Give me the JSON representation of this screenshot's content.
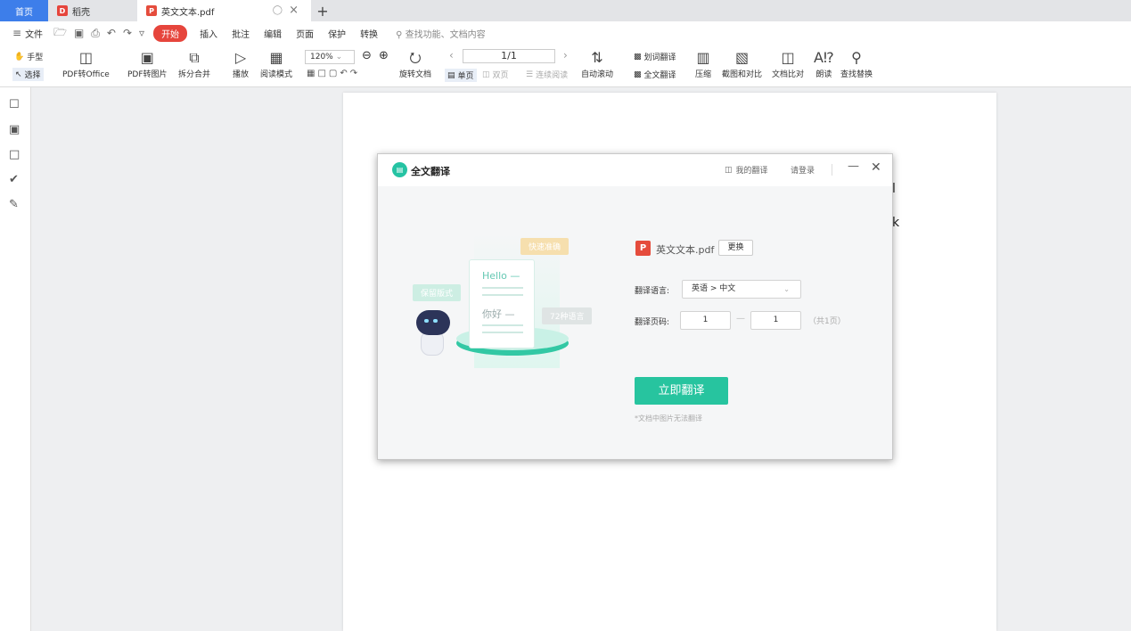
{
  "tabs": {
    "home": "首页",
    "daoke": "稻壳",
    "doc": "英文文本.pdf",
    "add": "+"
  },
  "menu": {
    "file": "文件",
    "start": "开始",
    "items": [
      "插入",
      "批注",
      "编辑",
      "页面",
      "保护",
      "转换"
    ],
    "search": "查找功能、文档内容"
  },
  "ribbon": {
    "hand": "手型",
    "select": "选择",
    "pdf_to_office": "PDF转Office",
    "pdf_to_image": "PDF转图片",
    "split_merge": "拆分合并",
    "play": "播放",
    "read_mode": "阅读模式",
    "zoom": "120%",
    "rotate": "旋转文档",
    "page_indicator": "1/1",
    "single_page": "单页",
    "double_page": "双页",
    "continuous": "连续阅读",
    "auto_scroll": "自动滚动",
    "word_translate": "划词翻译",
    "full_translate": "全文翻译",
    "compress": "压缩",
    "screenshot_compare": "截图和对比",
    "doc_compare": "文档比对",
    "read_aloud": "朗读",
    "find_replace": "查找替换"
  },
  "page_fragments": [
    "l",
    "k"
  ],
  "dialog": {
    "title": "全文翻译",
    "my_translation": "我的翻译",
    "login": "请登录",
    "file_name": "英文文本.pdf",
    "change": "更换",
    "lang_label": "翻译语言:",
    "lang_value": "英语 > 中文",
    "page_label": "翻译页码:",
    "page_from": "1",
    "page_to": "1",
    "page_dash": "—",
    "page_total": "（共1页）",
    "translate_btn": "立即翻译",
    "note": "*文档中图片无法翻译"
  },
  "illustration": {
    "bubble_fast": "快速准确",
    "bubble_keep": "保留版式",
    "bubble_72": "72种语言",
    "hello": "Hello —",
    "nihao": "你好 —"
  },
  "colors": {
    "accent": "#27c49f",
    "tab_home": "#3d7eea",
    "start_btn": "#e6453c",
    "pdf_icon": "#e54c3c"
  }
}
